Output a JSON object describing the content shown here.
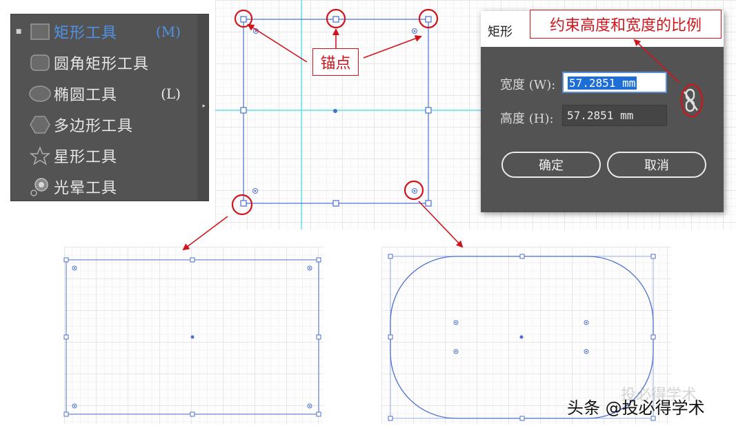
{
  "toolbox": {
    "items": [
      {
        "label": "矩形工具",
        "shortcut": "(M)",
        "icon": "rectangle-tool-icon",
        "active": true
      },
      {
        "label": "圆角矩形工具",
        "shortcut": "",
        "icon": "rounded-rectangle-tool-icon",
        "active": false
      },
      {
        "label": "椭圆工具",
        "shortcut": "(L)",
        "icon": "ellipse-tool-icon",
        "active": false
      },
      {
        "label": "多边形工具",
        "shortcut": "",
        "icon": "polygon-tool-icon",
        "active": false
      },
      {
        "label": "星形工具",
        "shortcut": "",
        "icon": "star-tool-icon",
        "active": false
      },
      {
        "label": "光晕工具",
        "shortcut": "",
        "icon": "flare-tool-icon",
        "active": false
      }
    ]
  },
  "dialog": {
    "title": "矩形",
    "width_label": "宽度 (W):",
    "width_value": "57.2851 mm",
    "height_label": "高度 (H):",
    "height_value": "57.2851 mm",
    "ok_label": "确定",
    "cancel_label": "取消",
    "constrain_icon": "link-constrain-icon"
  },
  "annotations": {
    "anchor_label": "锚点",
    "constrain_label": "约束高度和宽度的比例"
  },
  "watermark": {
    "text": "头条 @投必得学术",
    "ghost": "投必得学术"
  },
  "colors": {
    "annotation_red": "#d0141c",
    "selection_blue": "#4a6fd0",
    "guide_cyan": "#5fe0e6",
    "panel_gray": "#535353",
    "active_tool_blue": "#4f92e6"
  }
}
